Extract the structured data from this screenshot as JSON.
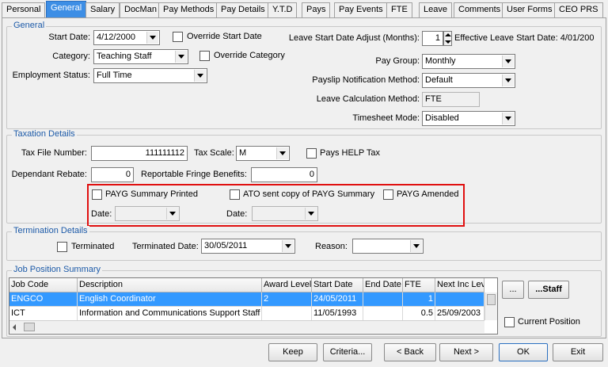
{
  "tabs": [
    "Personal",
    "General",
    "Salary",
    "DocMan",
    "Pay Methods",
    "Pay Details",
    "Y.T.D",
    "Pays",
    "Pay Events",
    "FTE",
    "Leave",
    "Comments",
    "User Forms",
    "CEO PRS"
  ],
  "active_tab": "General",
  "general": {
    "title": "General",
    "start_date_label": "Start Date:",
    "start_date": "4/12/2000",
    "override_start_date": "Override Start Date",
    "category_label": "Category:",
    "category": "Teaching Staff",
    "override_category": "Override Category",
    "employment_status_label": "Employment Status:",
    "employment_status": "Full Time",
    "leave_start_adjust_label": "Leave Start Date Adjust (Months):",
    "leave_start_adjust": "1",
    "effective_leave_start": "Effective Leave Start Date: 4/01/200",
    "pay_group_label": "Pay Group:",
    "pay_group": "Monthly",
    "payslip_notification_label": "Payslip Notification Method:",
    "payslip_notification": "Default",
    "leave_calc_label": "Leave Calculation Method:",
    "leave_calc": "FTE",
    "timesheet_mode_label": "Timesheet Mode:",
    "timesheet_mode": "Disabled"
  },
  "taxation": {
    "title": "Taxation Details",
    "tfn_label": "Tax File Number:",
    "tfn": "111111112",
    "tax_scale_label": "Tax Scale:",
    "tax_scale": "M",
    "pays_help_tax": "Pays HELP Tax",
    "dependant_rebate_label": "Dependant Rebate:",
    "dependant_rebate": "0",
    "rfb_label": "Reportable Fringe Benefits:",
    "rfb": "0",
    "payg_summary_printed": "PAYG Summary  Printed",
    "ato_sent_copy": "ATO sent copy of PAYG Summary",
    "payg_amended": "PAYG Amended",
    "date_label_1": "Date:",
    "date_label_2": "Date:"
  },
  "termination": {
    "title": "Termination Details",
    "terminated": "Terminated",
    "terminated_date_label": "Terminated Date:",
    "terminated_date": "30/05/2011",
    "reason_label": "Reason:",
    "reason": ""
  },
  "job_positions": {
    "title": "Job Position Summary",
    "columns": [
      "Job Code",
      "Description",
      "Award Level",
      "Start Date",
      "End Date",
      "FTE",
      "Next Inc Lev"
    ],
    "rows": [
      [
        "ENGCO",
        "English Coordinator",
        "2",
        "24/05/2011",
        "",
        "1",
        ""
      ],
      [
        "ICT",
        "Information and Communications Support Staff",
        "",
        "11/05/1993",
        "",
        "0.5",
        "25/09/2003"
      ]
    ],
    "ellipsis_button": "...",
    "staff_button": "...Staff",
    "current_position": "Current Position"
  },
  "footer": {
    "keep": "Keep",
    "criteria": "Criteria...",
    "back": "< Back",
    "next": "Next >",
    "ok": "OK",
    "exit": "Exit"
  },
  "colors": {
    "active_tab": "#3d8ee5",
    "group_title": "#1c5aa8",
    "highlight_box": "#e01010",
    "selected_row": "#3399ff"
  }
}
